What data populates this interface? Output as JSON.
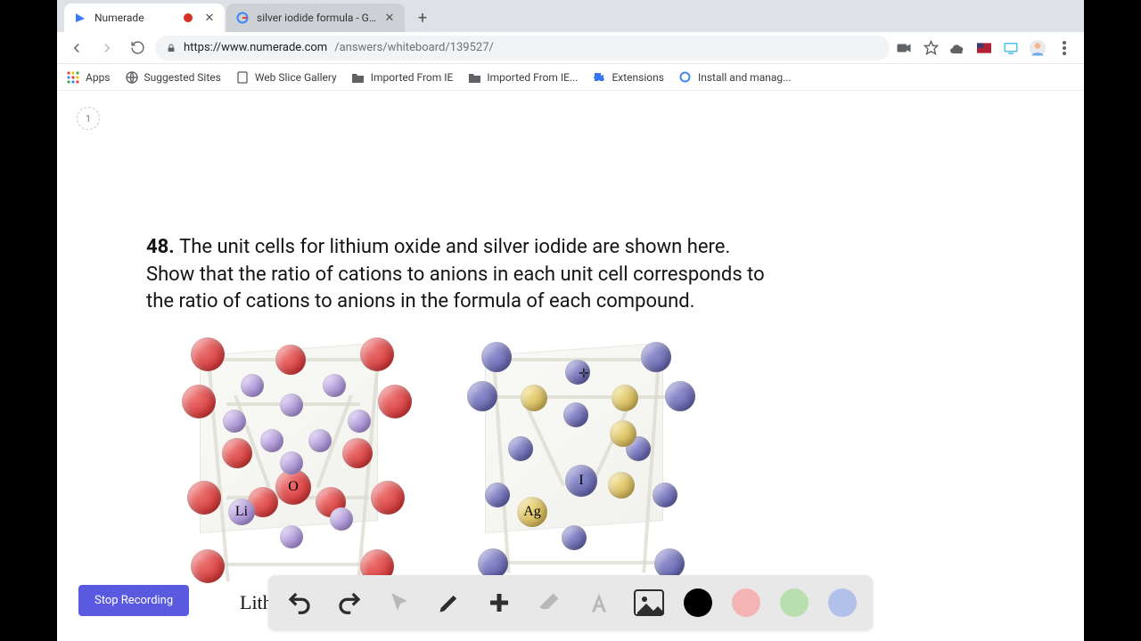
{
  "tabs": [
    {
      "title": "Numerade",
      "recording": true
    },
    {
      "title": "silver iodide formula - Google"
    }
  ],
  "url": {
    "host": "https://www.numerade.com",
    "path": "/answers/whiteboard/139527/"
  },
  "bookmarks": {
    "apps": "Apps",
    "suggested": "Suggested Sites",
    "gallery": "Web Slice Gallery",
    "import1": "Imported From IE",
    "import2": "Imported From IE...",
    "extensions": "Extensions",
    "install": "Install and manag..."
  },
  "page": {
    "badge": "1"
  },
  "question": {
    "number": "48.",
    "text": "The unit cells for lithium oxide and silver iodide are shown here. Show that the ratio of cations to anions in each unit cell corresponds to the ratio of cations to anions in the formula of each compound."
  },
  "labels": {
    "O": "O",
    "Li": "Li",
    "I": "I",
    "Ag": "Ag"
  },
  "caption": "Lithium",
  "stop_recording": "Stop Recording",
  "colors": {
    "black": "#000000",
    "pink": "#f4b4b4",
    "green": "#b9dfb0",
    "blue": "#b2c1ea"
  }
}
